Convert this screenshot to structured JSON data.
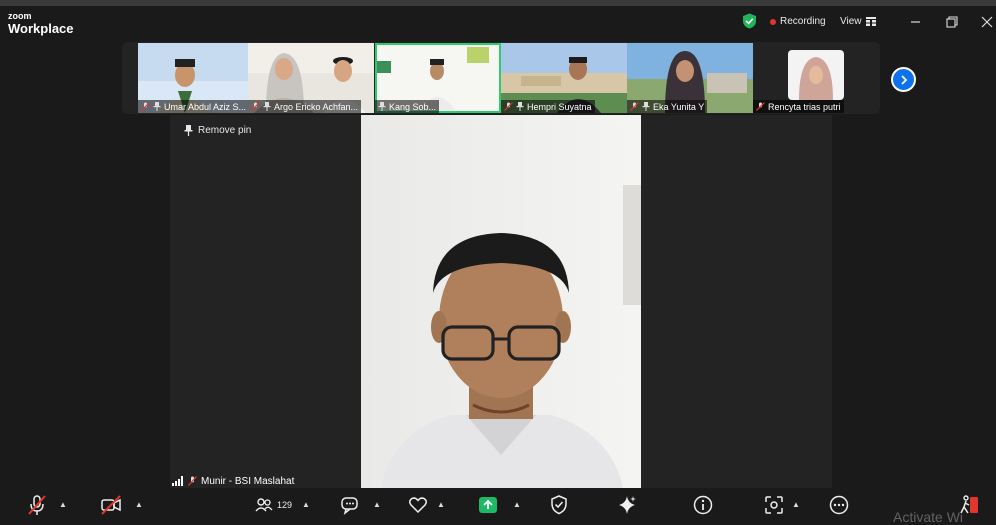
{
  "app": {
    "brand_small": "zoom",
    "brand_big": "Workplace"
  },
  "titlebar": {
    "recording": "Recording",
    "view": "View"
  },
  "participants": [
    {
      "name": "Umar Abdul Aziz S..."
    },
    {
      "name": "Argo Ericko Achfan..."
    },
    {
      "name": "Kang Sob..."
    },
    {
      "name": "Hempri Suyatna"
    },
    {
      "name": "Eka Yunita Y"
    },
    {
      "name": "Rencyta trias putri"
    }
  ],
  "stage": {
    "remove_pin": "Remove pin",
    "speaker_name": "Munir - BSI Maslahat"
  },
  "toolbar": {
    "participant_count": "129"
  },
  "watermark": "Activate Wi"
}
